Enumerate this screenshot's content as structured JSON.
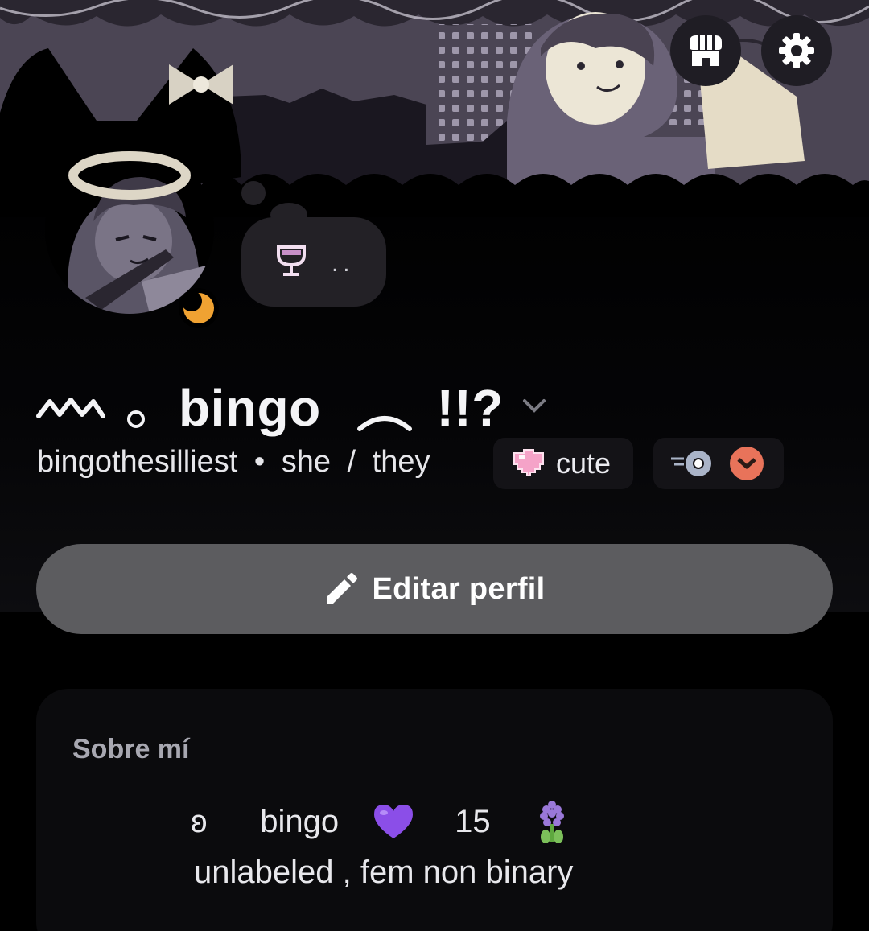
{
  "banner": {
    "background_color": "#4b4554"
  },
  "header_actions": {
    "shop_icon": "shop-icon",
    "settings_icon": "gear-icon"
  },
  "avatar": {
    "status": "idle",
    "status_color": "#f0a232"
  },
  "custom_status": {
    "emoji": "wine-glass-icon",
    "text": ".."
  },
  "profile": {
    "display_name_prefix_glyph": "ᨓ",
    "display_name": "bingo",
    "display_name_suffix": "!!?",
    "username": "bingothesilliest",
    "separator": "•",
    "pronouns_1": "she",
    "pronouns_slash": "/",
    "pronouns_2": "they"
  },
  "tag": {
    "icon": "pixel-heart-icon",
    "label": "cute",
    "accent": "#f5a3c8"
  },
  "badges": [
    {
      "name": "nitro-badge",
      "color": "#aab4c8"
    },
    {
      "name": "server-boost-badge",
      "color": "#e8735a"
    }
  ],
  "edit_profile": {
    "label": "Editar perfil",
    "icon": "pencil-icon"
  },
  "about": {
    "title": "Sobre mí",
    "line1": {
      "prefix": "ʚ",
      "name": "bingo",
      "heart": "purple-heart",
      "age": "15",
      "flower": "hyacinth"
    },
    "line2": "unlabeled ,  fem non binary"
  }
}
